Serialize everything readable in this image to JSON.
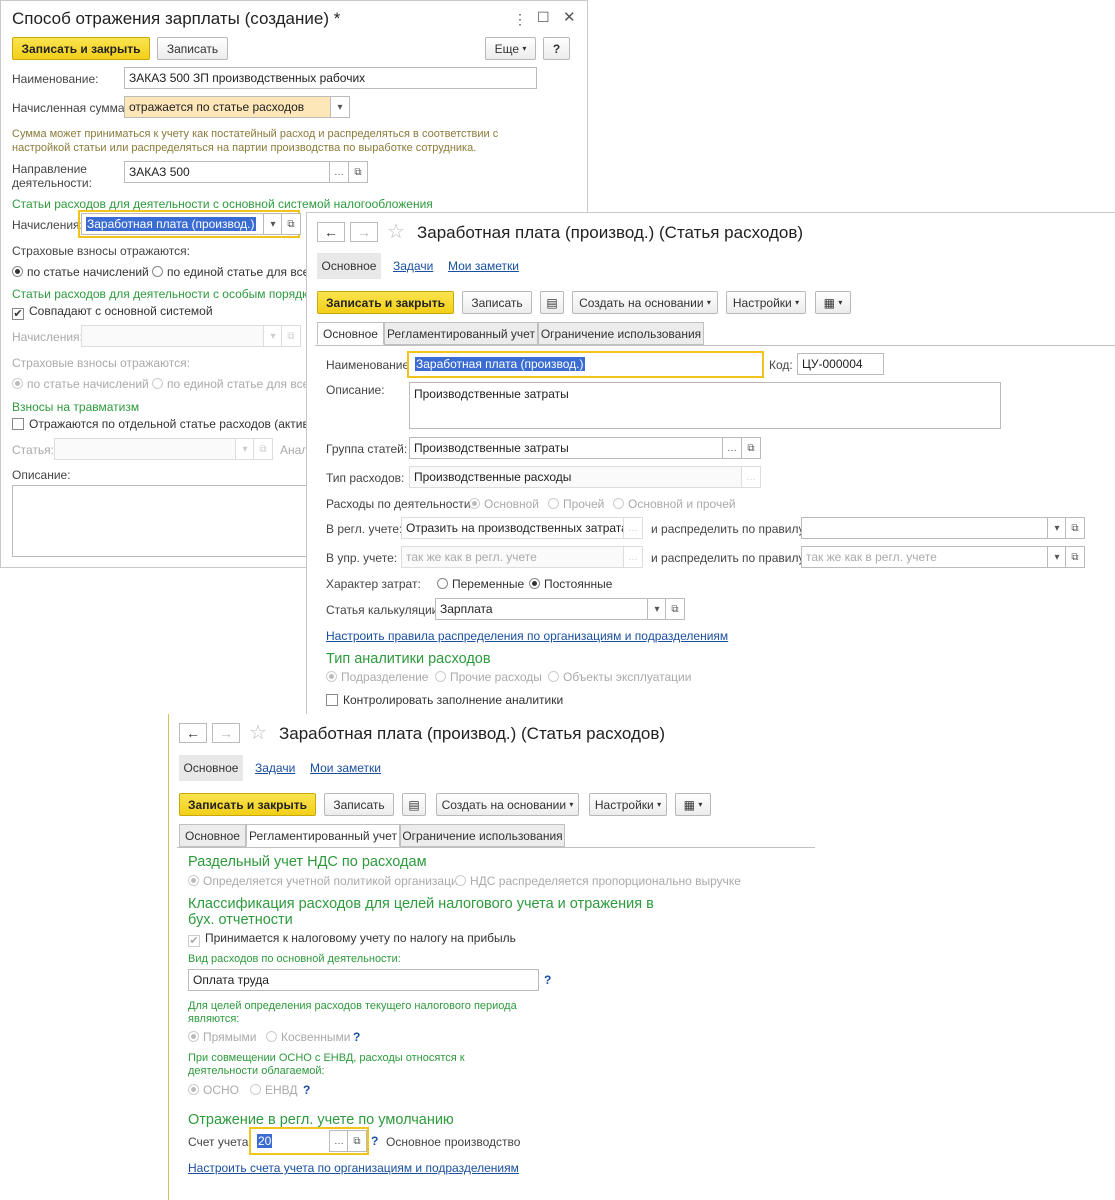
{
  "w1": {
    "title": "Способ отражения зарплаты (создание) *",
    "save_close": "Записать и закрыть",
    "save": "Записать",
    "more": "Еще",
    "help": "?",
    "name_label": "Наименование:",
    "name_value": "ЗАКАЗ 500 ЗП производственных рабочих",
    "accrued_label": "Начисленная сумма:",
    "accrued_value": "отражается по статье расходов",
    "note1": "Сумма может приниматься к учету как постатейный расход и распределяться в соответствии с",
    "note2": "настройкой статьи или распределяться на партии производства по выработке сотрудника.",
    "direction_label1": "Направление",
    "direction_label2": "деятельности:",
    "direction_value": "ЗАКАЗ 500",
    "section1": "Статьи расходов для деятельности с основной системой налогообложения",
    "accruals_label": "Начисления:",
    "accruals_value": "Заработная плата (производ.)",
    "insurance_label": "Страховые взносы отражаются:",
    "radio_by_accrual": "по статье начислений",
    "radio_single": "по единой статье для всех",
    "section2": "Статьи расходов для деятельности с особым порядком н",
    "same_as_main": "Совпадают с основной системой",
    "accruals2_label": "Начисления:",
    "insurance2_label": "Страховые взносы отражаются:",
    "radio2_by_accrual": "по статье начислений",
    "radio2_single": "по единой статье для всех",
    "injury_section": "Взносы на травматизм",
    "injury_check": "Отражаются по отдельной статье расходов (активов \\",
    "article_label": "Статья:",
    "analytics_label": "Анали",
    "description_label": "Описание:"
  },
  "w2": {
    "title": "Заработная плата (производ.) (Статья расходов)",
    "nav_main": "Основное",
    "nav_tasks": "Задачи",
    "nav_notes": "Мои заметки",
    "save_close": "Записать и закрыть",
    "save": "Записать",
    "create_based": "Создать на основании",
    "settings": "Настройки",
    "tabs": [
      "Основное",
      "Регламентированный учет",
      "Ограничение использования"
    ],
    "name_label": "Наименование:",
    "name_value": "Заработная плата (производ.)",
    "code_label": "Код:",
    "code_value": "ЦУ-000004",
    "desc_label": "Описание:",
    "desc_value": "Производственные затраты",
    "group_label": "Группа статей:",
    "group_value": "Производственные затраты",
    "type_label": "Тип расходов:",
    "type_value": "Производственные расходы",
    "activity_label": "Расходы по деятельности:",
    "activity_opts": [
      "Основной",
      "Прочей",
      "Основной и прочей"
    ],
    "reg_label": "В регл. учете:",
    "reg_value": "Отразить на производственных затратах",
    "distribute_label": "и распределить по правилу:",
    "mgmt_label": "В упр. учете:",
    "mgmt_placeholder": "так же как в регл. учете",
    "distribute2_label": "и распределить по правилу:",
    "distribute2_placeholder": "так же как в регл. учете",
    "nature_label": "Характер затрат:",
    "nature_opts": [
      "Переменные",
      "Постоянные"
    ],
    "calc_label": "Статья калькуляции:",
    "calc_value": "Зарплата",
    "rules_link": "Настроить правила распределения по организациям и подразделениям",
    "analytics_title": "Тип аналитики расходов",
    "analytics_opts": [
      "Подразделение",
      "Прочие расходы",
      "Объекты эксплуатации"
    ],
    "control_check": "Контролировать заполнение аналитики"
  },
  "w3": {
    "title": "Заработная плата (производ.) (Статья расходов)",
    "nav_main": "Основное",
    "nav_tasks": "Задачи",
    "nav_notes": "Мои заметки",
    "save_close": "Записать и закрыть",
    "save": "Записать",
    "create_based": "Создать на основании",
    "settings": "Настройки",
    "tabs": [
      "Основное",
      "Регламентированный учет",
      "Ограничение использования"
    ],
    "vat_title": "Раздельный учет НДС по расходам",
    "vat_opts": [
      "Определяется учетной политикой организации",
      "НДС распределяется пропорционально выручке"
    ],
    "class_title1": "Классификация расходов для целей налогового учета и отражения в",
    "class_title2": "бух. отчетности",
    "profit_check": "Принимается к налоговому учету по налогу на прибыль",
    "kind_label": "Вид расходов по основной деятельности:",
    "kind_value": "Оплата труда",
    "help_q": "?",
    "period_label1": "Для целей определения расходов текущего налогового периода",
    "period_label2": "являются:",
    "period_opts": [
      "Прямыми",
      "Косвенными"
    ],
    "envd_label1": "При совмещении ОСНО с ЕНВД, расходы относятся к",
    "envd_label2": "деятельности облагаемой:",
    "envd_opts": [
      "ОСНО",
      "ЕНВД"
    ],
    "default_title": "Отражение в регл. учете по умолчанию",
    "account_label": "Счет учета:",
    "account_value": "20",
    "account_name": "Основное производство",
    "accounts_link": "Настроить счета учета по организациям и подразделениям"
  },
  "colors": {
    "accent_yellow": "#f2cf17",
    "green_heading": "#2d9a3c",
    "link_blue": "#1a4fa0"
  }
}
